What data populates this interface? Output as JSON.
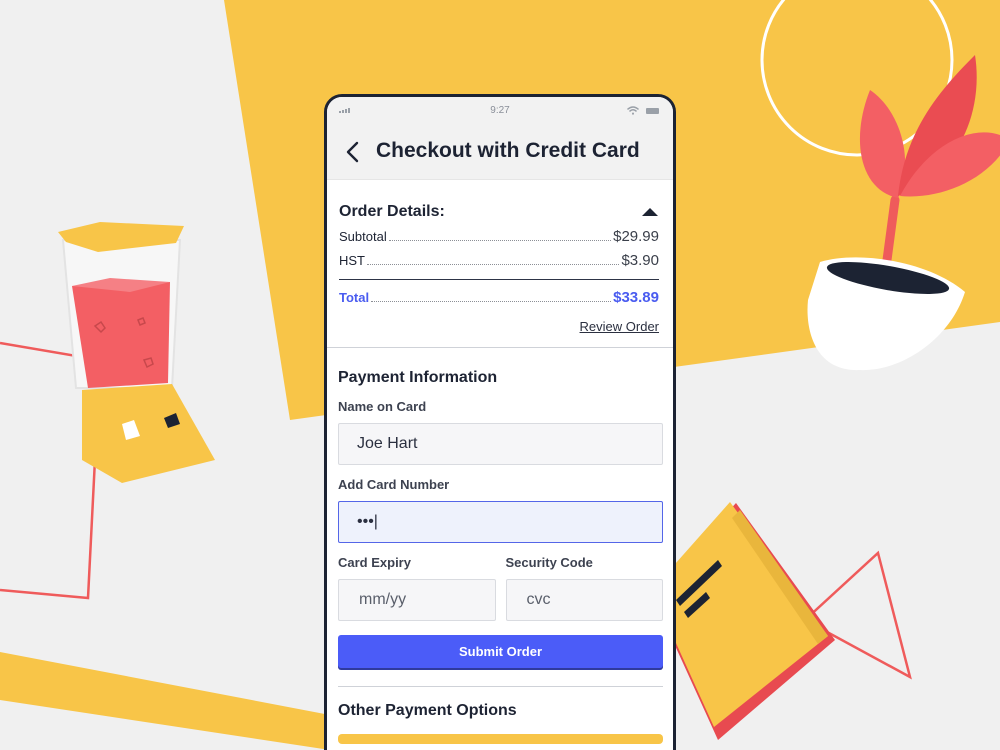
{
  "status_bar": {
    "time": "9:27"
  },
  "header": {
    "title": "Checkout with Credit Card",
    "back_icon": "chevron-left-icon"
  },
  "order_details": {
    "title": "Order Details:",
    "toggle_icon": "caret-up-icon",
    "lines": [
      {
        "label": "Subtotal",
        "amount": "$29.99"
      },
      {
        "label": "HST",
        "amount": "$3.90"
      }
    ],
    "total": {
      "label": "Total",
      "amount": "$33.89"
    },
    "review_link": "Review Order"
  },
  "payment": {
    "title": "Payment Information",
    "name_label": "Name on Card",
    "name_value": "Joe Hart",
    "card_label": "Add Card Number",
    "card_value": "•••|",
    "expiry_label": "Card Expiry",
    "expiry_placeholder": "mm/yy",
    "security_label": "Security Code",
    "security_placeholder": "cvc",
    "submit_label": "Submit Order"
  },
  "other_payment": {
    "title": "Other Payment Options"
  },
  "colors": {
    "accent": "#4b5cf8",
    "total_text": "#4a5cf0",
    "background_yellow": "#f8c548",
    "background_gray": "#f0f0f0",
    "decor_red": "#ef5b5b"
  }
}
